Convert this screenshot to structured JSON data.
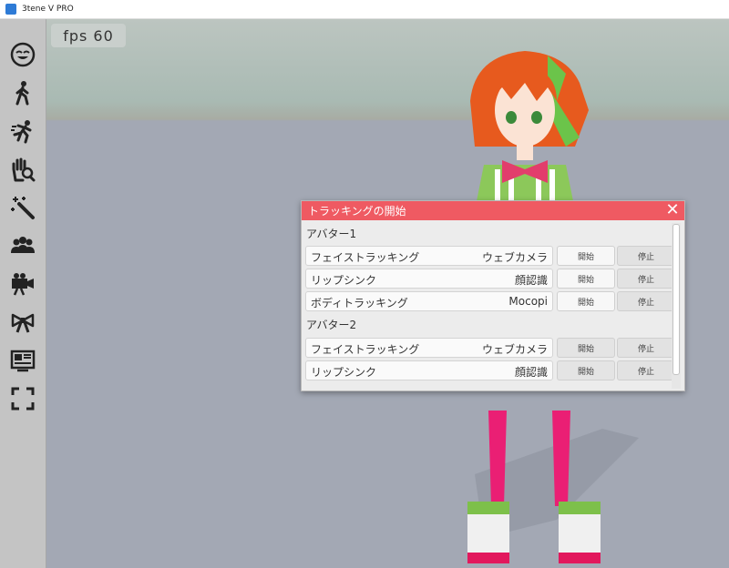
{
  "window": {
    "title": "3tene V PRO",
    "icon": "app-icon"
  },
  "sidebar": {
    "items": [
      {
        "name": "face-icon"
      },
      {
        "name": "walking-person-icon"
      },
      {
        "name": "running-person-icon"
      },
      {
        "name": "hand-search-icon"
      },
      {
        "name": "magic-wand-icon"
      },
      {
        "name": "people-group-icon"
      },
      {
        "name": "video-camera-icon"
      },
      {
        "name": "bow-ribbon-icon"
      },
      {
        "name": "monitor-card-icon"
      },
      {
        "name": "fullscreen-icon"
      }
    ]
  },
  "viewport": {
    "fps_text": "fps  60"
  },
  "dialog": {
    "title": "トラッキングの開始",
    "close_symbol": "✕",
    "avatar1": {
      "heading": "アバター1",
      "rows": [
        {
          "label": "フェイストラッキング",
          "value": "ウェブカメラ",
          "start": "開始",
          "stop": "停止"
        },
        {
          "label": "リップシンク",
          "value": "顔認識",
          "start": "開始",
          "stop": "停止"
        },
        {
          "label": "ボディトラッキング",
          "value": "Mocopi",
          "start": "開始",
          "stop": "停止"
        }
      ]
    },
    "avatar2": {
      "heading": "アバター2",
      "rows": [
        {
          "label": "フェイストラッキング",
          "value": "ウェブカメラ",
          "start": "開始",
          "stop": "停止"
        },
        {
          "label": "リップシンク",
          "value": "顔認識",
          "start": "開始",
          "stop": "停止"
        }
      ]
    }
  },
  "colors": {
    "dialog_title": "#ef5a62",
    "sidebar": "#c4c4c4",
    "viewport_bg": "#a3a8b4"
  }
}
